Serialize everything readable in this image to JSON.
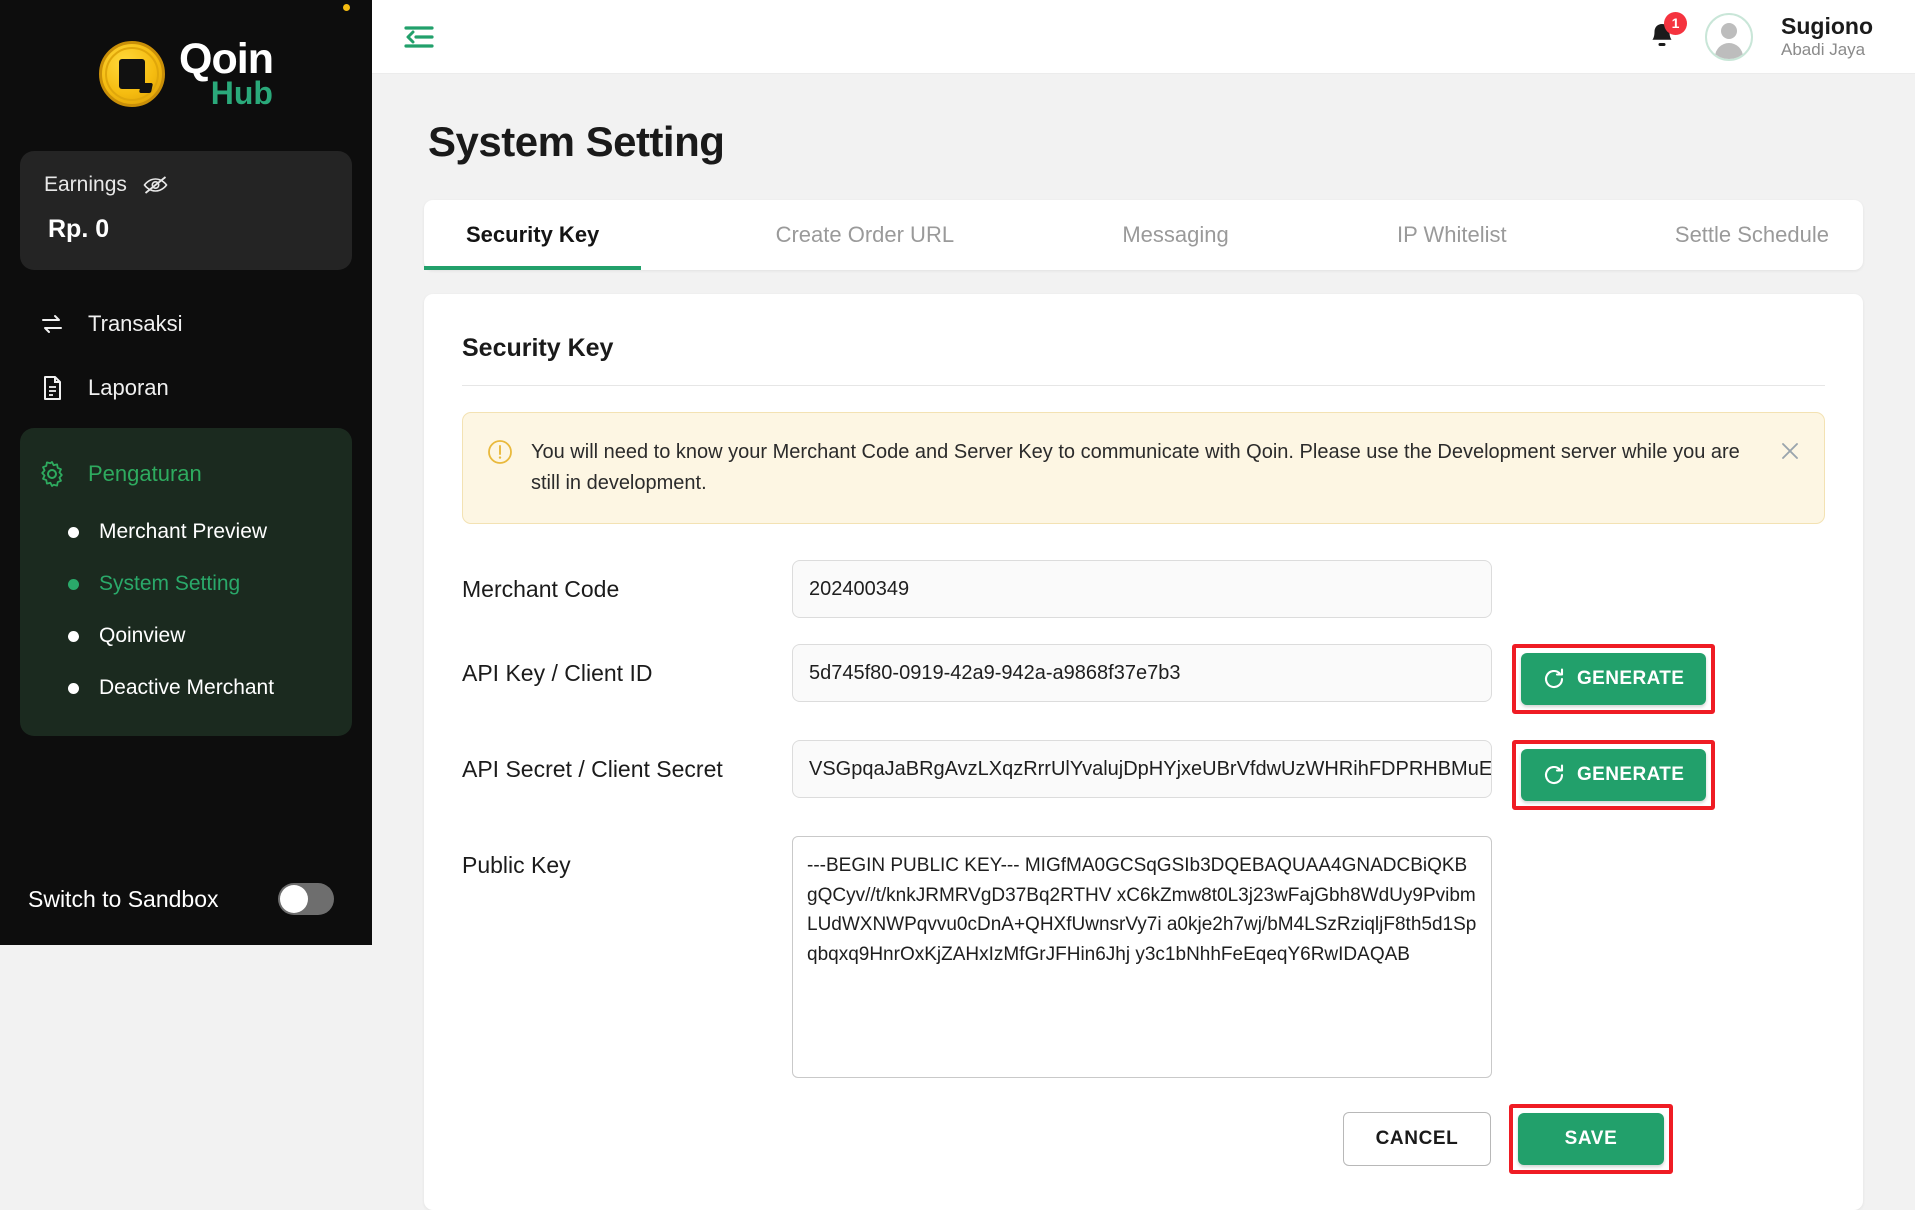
{
  "sidebar": {
    "logo": {
      "primary": "Qoin",
      "secondary": "Hub"
    },
    "earnings": {
      "label": "Earnings",
      "value": "Rp. 0",
      "eye_icon": "eye-off-icon"
    },
    "nav": [
      {
        "label": "Transaksi",
        "icon": "transfer-icon"
      },
      {
        "label": "Laporan",
        "icon": "document-icon"
      }
    ],
    "group": {
      "label": "Pengaturan",
      "icon": "gear-icon",
      "items": [
        {
          "label": "Merchant Preview",
          "active": false
        },
        {
          "label": "System Setting",
          "active": true
        },
        {
          "label": "Qoinview",
          "active": false
        },
        {
          "label": "Deactive Merchant",
          "active": false
        }
      ]
    },
    "sandbox": {
      "label": "Switch to Sandbox",
      "state": "off"
    }
  },
  "topbar": {
    "collapse_icon": "collapse-sidebar-icon",
    "notification": {
      "icon": "bell-icon",
      "count": "1"
    },
    "user": {
      "name": "Sugiono",
      "company": "Abadi Jaya",
      "avatar_icon": "user-avatar-icon"
    }
  },
  "page": {
    "title": "System Setting",
    "tabs": [
      {
        "label": "Security Key",
        "active": true
      },
      {
        "label": "Create Order URL",
        "active": false
      },
      {
        "label": "Messaging",
        "active": false
      },
      {
        "label": "IP Whitelist",
        "active": false
      },
      {
        "label": "Settle Schedule",
        "active": false
      }
    ],
    "panel_title": "Security Key",
    "alert": {
      "icon": "warning-circle-icon",
      "text": "You will need to know your Merchant Code and Server Key to communicate with Qoin. Please use the Development server while you are still in development.",
      "close_icon": "close-icon"
    },
    "fields": {
      "merchant_code": {
        "label": "Merchant Code",
        "value": "202400349"
      },
      "api_key": {
        "label": "API Key / Client ID",
        "value": "5d745f80-0919-42a9-942a-a9868f37e7b3"
      },
      "api_secret": {
        "label": "API Secret / Client Secret",
        "value": "VSGpqaJaBRgAvzLXqzRrrUlYvalujDpHYjxeUBrVfdwUzWHRihFDPRHBMuE"
      },
      "public_key": {
        "label": "Public Key",
        "value": "---BEGIN PUBLIC KEY---\nMIGfMA0GCSqGSIb3DQEBAQUAA4GNADCBiQKBgQCyv//t/knkJRMRVgD37Bq2RTHV\nxC6kZmw8t0L3j23wFajGbh8WdUy9PvibmLUdWXNWPqvvu0cDnA+QHXfUwnsrVy7i\na0kje2h7wj/bM4LSzRziqljF8th5d1Spqbqxq9HnrOxKjZAHxIzMfGrJFHin6Jhj\ny3c1bNhhFeEqeqY6RwIDAQAB"
      }
    },
    "buttons": {
      "generate_api_key": "GENERATE",
      "generate_api_secret": "GENERATE",
      "cancel": "CANCEL",
      "save": "SAVE"
    }
  },
  "colors": {
    "brand_green": "#22a06b",
    "sidebar_bg": "#0d0d0d",
    "alert_bg": "#fdf6e3",
    "highlight_red": "#ef1c24",
    "badge_red": "#f5333f"
  }
}
